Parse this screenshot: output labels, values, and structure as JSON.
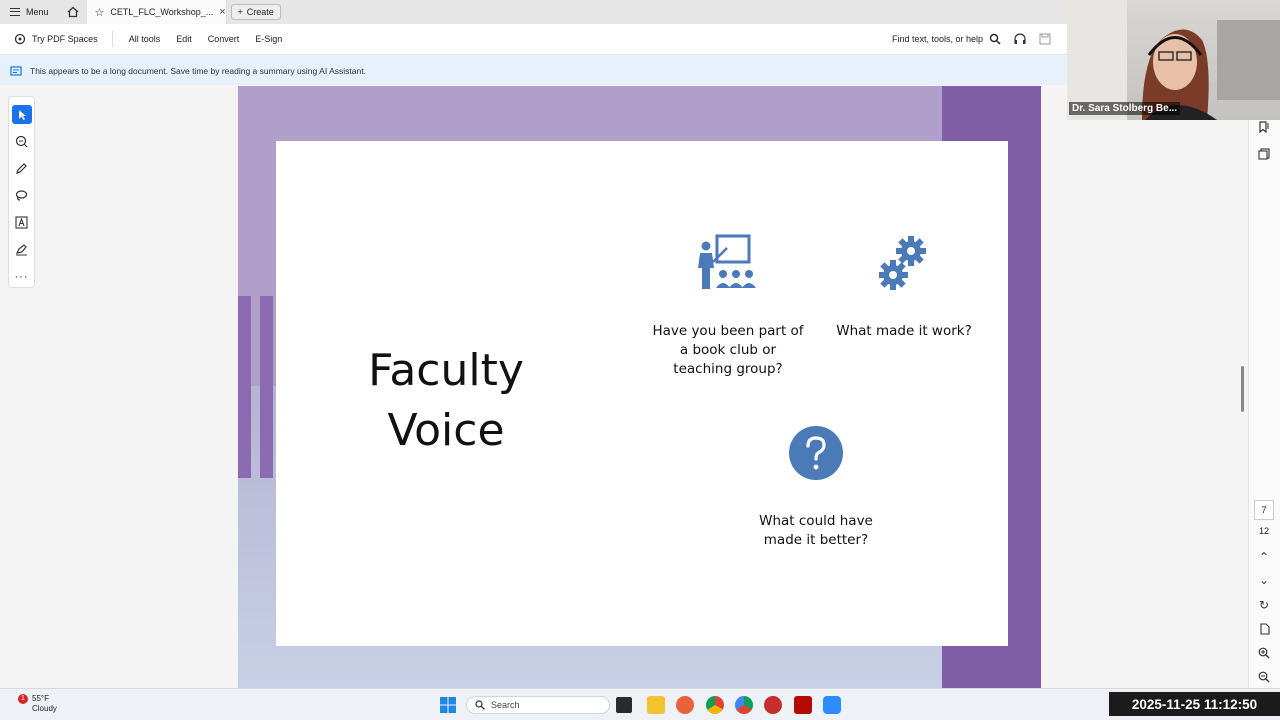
{
  "tabbar": {
    "menu_label": "Menu",
    "tab_title": "CETL_FLC_Workshop_...",
    "create_label": "Create"
  },
  "toolbar": {
    "try_pdf_spaces": "Try PDF Spaces",
    "all_tools": "All tools",
    "edit": "Edit",
    "convert": "Convert",
    "esign": "E-Sign",
    "find_placeholder": "Find text, tools, or help"
  },
  "banner": {
    "text": "This appears to be a long document. Save time by reading a summary using AI Assistant."
  },
  "slide": {
    "title_line1": "Faculty",
    "title_line2": "Voice",
    "q1": "Have you been part of a book club or teaching group?",
    "q2": "What made it work?",
    "q3": "What could have made it better?",
    "accent_color": "#4a7ab8"
  },
  "page_nav": {
    "current_page": "7",
    "total_pages": "12"
  },
  "video": {
    "participant_name": "Dr. Sara Stolberg Be..."
  },
  "taskbar": {
    "weather_temp": "55°F",
    "weather_cond": "Cloudy",
    "weather_badge": "1",
    "search_label": "Search"
  },
  "clock": {
    "datetime": "2025-11-25  11:12:50"
  }
}
